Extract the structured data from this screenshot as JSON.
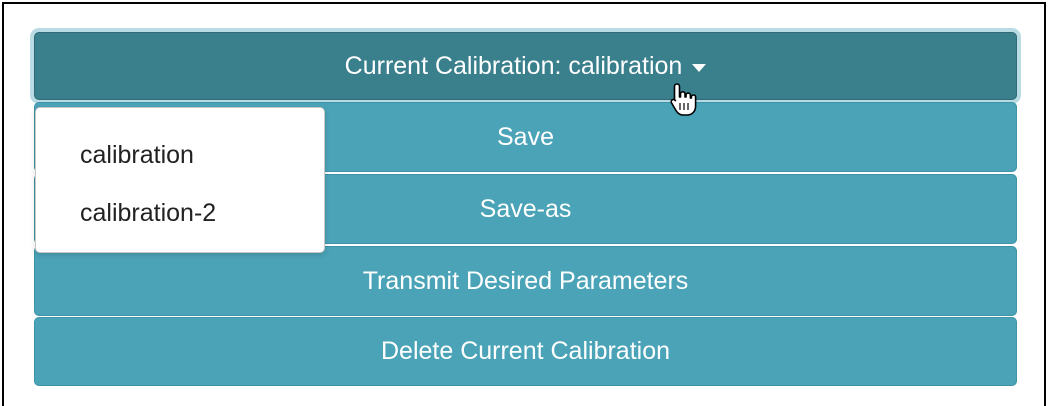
{
  "toggle": {
    "label": "Current Calibration: calibration",
    "icon": "caret-down-icon"
  },
  "buttons": {
    "save": "Save",
    "save_as": "Save-as",
    "transmit": "Transmit Desired Parameters",
    "delete": "Delete Current Calibration"
  },
  "dropdown": {
    "items": [
      {
        "label": "calibration"
      },
      {
        "label": "calibration-2"
      }
    ]
  },
  "colors": {
    "toggle_bg": "#3a7f8c",
    "button_bg": "#4ba3b7",
    "focus_ring": "#b9dbe3"
  },
  "cursor": {
    "icon": "hand-pointer-icon"
  }
}
